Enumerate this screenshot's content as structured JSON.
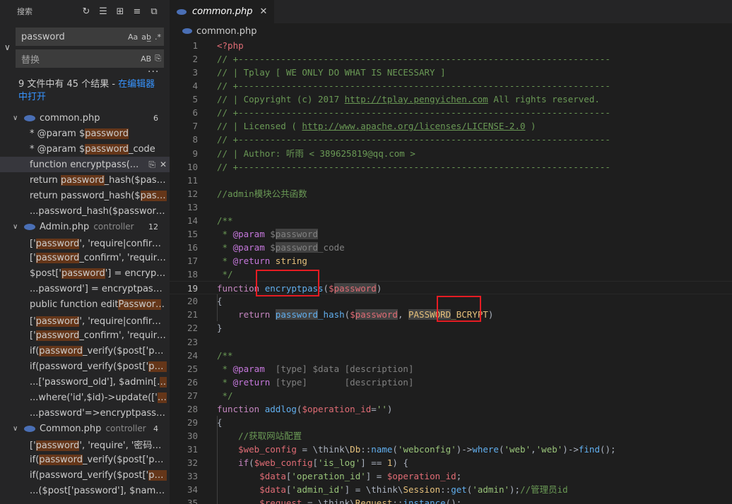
{
  "sidebar": {
    "title": "搜索",
    "search_value": "password",
    "search_opts": [
      "Aa",
      "ab̲",
      ".*"
    ],
    "replace_placeholder": "替换",
    "replace_opt": "AB",
    "summary_text": "9 文件中有 45 个结果 - ",
    "summary_link": "在编辑器中打开",
    "files": [
      {
        "name": "common.php",
        "dir": "",
        "count": "6",
        "matches": [
          {
            "pre": "* @param $",
            "hit": "password",
            "post": ""
          },
          {
            "pre": "* @param $",
            "hit": "password",
            "post": "_code"
          },
          {
            "pre": "function encryptpass(...",
            "hit": "",
            "post": "",
            "selected": true
          },
          {
            "pre": "return ",
            "hit": "password",
            "post": "_hash($passwor..."
          },
          {
            "pre": "return password_hash($",
            "hit": "passwor",
            "post": "..."
          },
          {
            "pre": "...password_hash($password, ",
            "hit": "PA",
            "post": "..."
          }
        ]
      },
      {
        "name": "Admin.php",
        "dir": "controller",
        "count": "12",
        "matches": [
          {
            "pre": "['",
            "hit": "password",
            "post": "', 'require|confirm', '密..."
          },
          {
            "pre": "['",
            "hit": "password",
            "post": "_confirm', 'require', '..."
          },
          {
            "pre": "$post['",
            "hit": "password",
            "post": "'] = encryptpass..."
          },
          {
            "pre": "...password'] = encryptpass($pos...",
            "hit": "",
            "post": ""
          },
          {
            "pre": "public function edit",
            "hit": "Password",
            "post": "()"
          },
          {
            "pre": "['",
            "hit": "password",
            "post": "', 'require|confirm', '密..."
          },
          {
            "pre": "['",
            "hit": "password",
            "post": "_confirm', 'require', '..."
          },
          {
            "pre": "if(",
            "hit": "password",
            "post": "_verify($post['passwo..."
          },
          {
            "pre": "if(password_verify($post['",
            "hit": "passwo",
            "post": "..."
          },
          {
            "pre": "...['password_old'], $admin['",
            "hit": "pass",
            "post": "..."
          },
          {
            "pre": "...where('id',$id)->update(['",
            "hit": "pass",
            "post": "..."
          },
          {
            "pre": "...password'=>encryptpass($pos...",
            "hit": "",
            "post": ""
          }
        ]
      },
      {
        "name": "Common.php",
        "dir": "controller",
        "count": "4",
        "matches": [
          {
            "pre": "['",
            "hit": "password",
            "post": "', 'require', '密码不能..."
          },
          {
            "pre": "if(",
            "hit": "password",
            "post": "_verify($post['passwo..."
          },
          {
            "pre": "if(password_verify($post['",
            "hit": "passwo",
            "post": "..."
          },
          {
            "pre": "...($post['password'], $name['",
            "hit": "pas",
            "post": "..."
          }
        ]
      }
    ]
  },
  "editor": {
    "tab_label": "common.php",
    "breadcrumb": "common.php",
    "active_line": 19,
    "lines": [
      {
        "n": 1,
        "html": "<span class='c-tag'>&lt;?php</span>"
      },
      {
        "n": 2,
        "html": "<span class='c-com'>// +----------------------------------------------------------------------</span>"
      },
      {
        "n": 3,
        "html": "<span class='c-com'>// | Tplay [ WE ONLY DO WHAT IS NECESSARY ]</span>"
      },
      {
        "n": 4,
        "html": "<span class='c-com'>// +----------------------------------------------------------------------</span>"
      },
      {
        "n": 5,
        "html": "<span class='c-com'>// | Copyright (c) 2017 <span class='c-url'>http://tplay.pengyichen.com</span> All rights reserved.</span>"
      },
      {
        "n": 6,
        "html": "<span class='c-com'>// +----------------------------------------------------------------------</span>"
      },
      {
        "n": 7,
        "html": "<span class='c-com'>// | Licensed ( <span class='c-url'>http://www.apache.org/licenses/LICENSE-2.0</span> )</span>"
      },
      {
        "n": 8,
        "html": "<span class='c-com'>// +----------------------------------------------------------------------</span>"
      },
      {
        "n": 9,
        "html": "<span class='c-com'>// | Author: 听雨 &lt; 389625819@qq.com &gt;</span>"
      },
      {
        "n": 10,
        "html": "<span class='c-com'>// +----------------------------------------------------------------------</span>"
      },
      {
        "n": 11,
        "html": ""
      },
      {
        "n": 12,
        "html": "<span class='c-com'>//admin模块公共函数</span>"
      },
      {
        "n": 13,
        "html": ""
      },
      {
        "n": 14,
        "html": "<span class='c-com'>/**</span>"
      },
      {
        "n": 15,
        "html": "<span class='c-com'> * </span><span class='c-doc'>@param</span> <span class='c-dt'>$<span class='mk'>password</span></span>"
      },
      {
        "n": 16,
        "html": "<span class='c-com'> * </span><span class='c-doc'>@param</span> <span class='c-dt'>$<span class='mk'>password</span>_code</span>"
      },
      {
        "n": 17,
        "html": "<span class='c-com'> * </span><span class='c-doc'>@return</span> <span class='c-ty'>string</span>"
      },
      {
        "n": 18,
        "html": "<span class='c-com'> */</span>"
      },
      {
        "n": 19,
        "html": "<span class='c-kw'>function</span> <span class='c-fn'>encryptpass</span><span class='c-pl'>(</span><span class='c-var'>$<span class='mk'>password</span></span><span class='c-pl'>)</span>"
      },
      {
        "n": 20,
        "html": "<span class='c-pl'>{</span>"
      },
      {
        "n": 21,
        "html": "    <span class='c-kw'>return</span> <span class='c-fn mk'>password</span><span class='c-fn'>_hash</span><span class='c-pl'>(</span><span class='c-var'>$<span class='mk'>password</span></span><span class='c-pl'>, </span><span class='c-cls mk'>PASSWORD</span><span class='c-cls'>_BCRYPT</span><span class='c-pl'>)</span>"
      },
      {
        "n": 22,
        "html": "<span class='c-pl'>}</span>"
      },
      {
        "n": 23,
        "html": ""
      },
      {
        "n": 24,
        "html": "<span class='c-com'>/**</span>"
      },
      {
        "n": 25,
        "html": "<span class='c-com'> * </span><span class='c-doc'>@param</span>  <span class='c-dt'>[type] $data [description]</span>"
      },
      {
        "n": 26,
        "html": "<span class='c-com'> * </span><span class='c-doc'>@return</span> <span class='c-dt'>[type]       [description]</span>"
      },
      {
        "n": 27,
        "html": "<span class='c-com'> */</span>"
      },
      {
        "n": 28,
        "html": "<span class='c-kw'>function</span> <span class='c-fn'>addlog</span><span class='c-pl'>(</span><span class='c-var'>$operation_id</span><span class='c-pl'>=</span><span class='c-str'>''</span><span class='c-pl'>)</span>"
      },
      {
        "n": 29,
        "html": "<span class='c-pl'>{</span>"
      },
      {
        "n": 30,
        "html": "    <span class='c-com'>//获取网站配置</span>"
      },
      {
        "n": 31,
        "html": "    <span class='c-var'>$web_config</span> <span class='c-pl'>= \\think\\</span><span class='c-cls'>Db</span><span class='c-pl'>::</span><span class='c-fn'>name</span><span class='c-pl'>(</span><span class='c-str'>'webconfig'</span><span class='c-pl'>)-&gt;</span><span class='c-fn'>where</span><span class='c-pl'>(</span><span class='c-str'>'web'</span><span class='c-pl'>,</span><span class='c-str'>'web'</span><span class='c-pl'>)-&gt;</span><span class='c-fn'>find</span><span class='c-pl'>();</span>"
      },
      {
        "n": 32,
        "html": "    <span class='c-kw'>if</span><span class='c-pl'>(</span><span class='c-var'>$web_config</span><span class='c-pl'>[</span><span class='c-str'>'is_log'</span><span class='c-pl'>] == </span><span class='c-cls'>1</span><span class='c-pl'>) {</span>"
      },
      {
        "n": 33,
        "html": "        <span class='c-var'>$data</span><span class='c-pl'>[</span><span class='c-str'>'operation_id'</span><span class='c-pl'>] = </span><span class='c-var'>$operation_id</span><span class='c-pl'>;</span>"
      },
      {
        "n": 34,
        "html": "        <span class='c-var'>$data</span><span class='c-pl'>[</span><span class='c-str'>'admin_id'</span><span class='c-pl'>] = \\think\\</span><span class='c-cls'>Session</span><span class='c-pl'>::</span><span class='c-fn'>get</span><span class='c-pl'>(</span><span class='c-str'>'admin'</span><span class='c-pl'>);</span><span class='c-com'>//管理员id</span>"
      },
      {
        "n": 35,
        "html": "        <span class='c-var'>$request</span> <span class='c-pl'>= \\think\\</span><span class='c-cls'>Request</span><span class='c-pl'>::</span><span class='c-fn'>instance</span><span class='c-pl'>();</span>"
      }
    ]
  }
}
